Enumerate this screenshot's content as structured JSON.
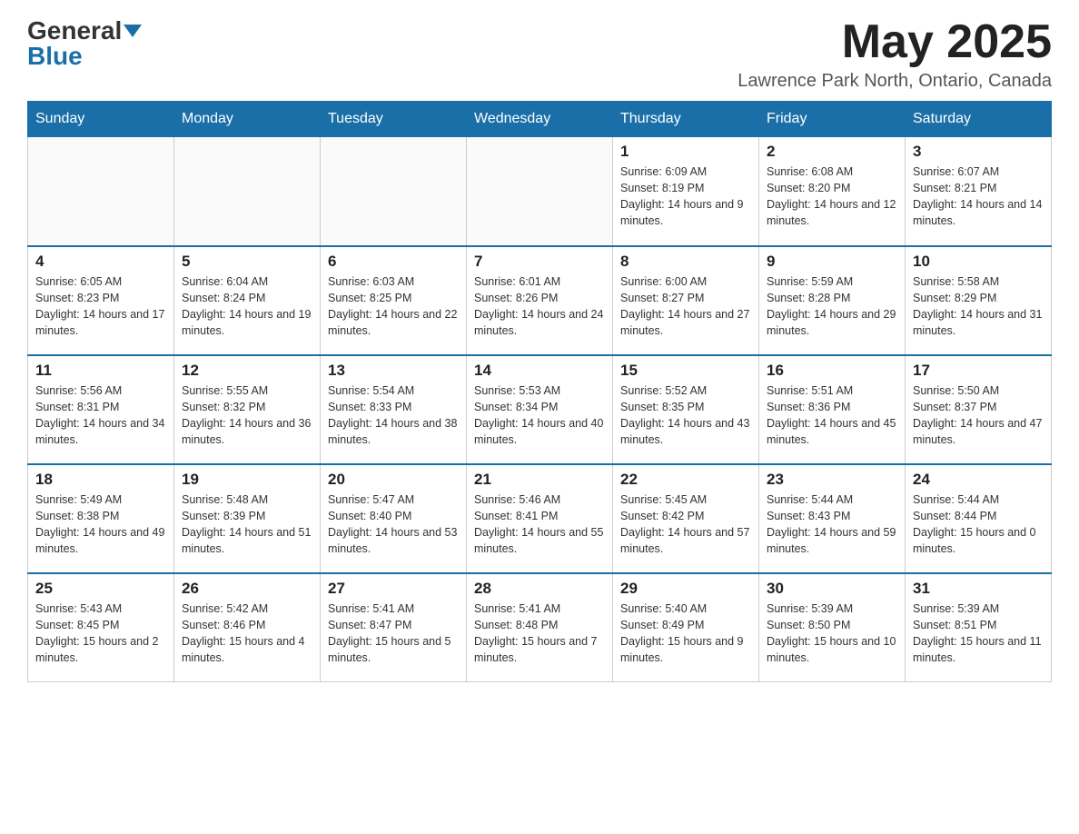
{
  "header": {
    "logo_general": "General",
    "logo_blue": "Blue",
    "month_title": "May 2025",
    "location": "Lawrence Park North, Ontario, Canada"
  },
  "days_of_week": [
    "Sunday",
    "Monday",
    "Tuesday",
    "Wednesday",
    "Thursday",
    "Friday",
    "Saturday"
  ],
  "weeks": [
    [
      {
        "day": "",
        "info": ""
      },
      {
        "day": "",
        "info": ""
      },
      {
        "day": "",
        "info": ""
      },
      {
        "day": "",
        "info": ""
      },
      {
        "day": "1",
        "info": "Sunrise: 6:09 AM\nSunset: 8:19 PM\nDaylight: 14 hours and 9 minutes."
      },
      {
        "day": "2",
        "info": "Sunrise: 6:08 AM\nSunset: 8:20 PM\nDaylight: 14 hours and 12 minutes."
      },
      {
        "day": "3",
        "info": "Sunrise: 6:07 AM\nSunset: 8:21 PM\nDaylight: 14 hours and 14 minutes."
      }
    ],
    [
      {
        "day": "4",
        "info": "Sunrise: 6:05 AM\nSunset: 8:23 PM\nDaylight: 14 hours and 17 minutes."
      },
      {
        "day": "5",
        "info": "Sunrise: 6:04 AM\nSunset: 8:24 PM\nDaylight: 14 hours and 19 minutes."
      },
      {
        "day": "6",
        "info": "Sunrise: 6:03 AM\nSunset: 8:25 PM\nDaylight: 14 hours and 22 minutes."
      },
      {
        "day": "7",
        "info": "Sunrise: 6:01 AM\nSunset: 8:26 PM\nDaylight: 14 hours and 24 minutes."
      },
      {
        "day": "8",
        "info": "Sunrise: 6:00 AM\nSunset: 8:27 PM\nDaylight: 14 hours and 27 minutes."
      },
      {
        "day": "9",
        "info": "Sunrise: 5:59 AM\nSunset: 8:28 PM\nDaylight: 14 hours and 29 minutes."
      },
      {
        "day": "10",
        "info": "Sunrise: 5:58 AM\nSunset: 8:29 PM\nDaylight: 14 hours and 31 minutes."
      }
    ],
    [
      {
        "day": "11",
        "info": "Sunrise: 5:56 AM\nSunset: 8:31 PM\nDaylight: 14 hours and 34 minutes."
      },
      {
        "day": "12",
        "info": "Sunrise: 5:55 AM\nSunset: 8:32 PM\nDaylight: 14 hours and 36 minutes."
      },
      {
        "day": "13",
        "info": "Sunrise: 5:54 AM\nSunset: 8:33 PM\nDaylight: 14 hours and 38 minutes."
      },
      {
        "day": "14",
        "info": "Sunrise: 5:53 AM\nSunset: 8:34 PM\nDaylight: 14 hours and 40 minutes."
      },
      {
        "day": "15",
        "info": "Sunrise: 5:52 AM\nSunset: 8:35 PM\nDaylight: 14 hours and 43 minutes."
      },
      {
        "day": "16",
        "info": "Sunrise: 5:51 AM\nSunset: 8:36 PM\nDaylight: 14 hours and 45 minutes."
      },
      {
        "day": "17",
        "info": "Sunrise: 5:50 AM\nSunset: 8:37 PM\nDaylight: 14 hours and 47 minutes."
      }
    ],
    [
      {
        "day": "18",
        "info": "Sunrise: 5:49 AM\nSunset: 8:38 PM\nDaylight: 14 hours and 49 minutes."
      },
      {
        "day": "19",
        "info": "Sunrise: 5:48 AM\nSunset: 8:39 PM\nDaylight: 14 hours and 51 minutes."
      },
      {
        "day": "20",
        "info": "Sunrise: 5:47 AM\nSunset: 8:40 PM\nDaylight: 14 hours and 53 minutes."
      },
      {
        "day": "21",
        "info": "Sunrise: 5:46 AM\nSunset: 8:41 PM\nDaylight: 14 hours and 55 minutes."
      },
      {
        "day": "22",
        "info": "Sunrise: 5:45 AM\nSunset: 8:42 PM\nDaylight: 14 hours and 57 minutes."
      },
      {
        "day": "23",
        "info": "Sunrise: 5:44 AM\nSunset: 8:43 PM\nDaylight: 14 hours and 59 minutes."
      },
      {
        "day": "24",
        "info": "Sunrise: 5:44 AM\nSunset: 8:44 PM\nDaylight: 15 hours and 0 minutes."
      }
    ],
    [
      {
        "day": "25",
        "info": "Sunrise: 5:43 AM\nSunset: 8:45 PM\nDaylight: 15 hours and 2 minutes."
      },
      {
        "day": "26",
        "info": "Sunrise: 5:42 AM\nSunset: 8:46 PM\nDaylight: 15 hours and 4 minutes."
      },
      {
        "day": "27",
        "info": "Sunrise: 5:41 AM\nSunset: 8:47 PM\nDaylight: 15 hours and 5 minutes."
      },
      {
        "day": "28",
        "info": "Sunrise: 5:41 AM\nSunset: 8:48 PM\nDaylight: 15 hours and 7 minutes."
      },
      {
        "day": "29",
        "info": "Sunrise: 5:40 AM\nSunset: 8:49 PM\nDaylight: 15 hours and 9 minutes."
      },
      {
        "day": "30",
        "info": "Sunrise: 5:39 AM\nSunset: 8:50 PM\nDaylight: 15 hours and 10 minutes."
      },
      {
        "day": "31",
        "info": "Sunrise: 5:39 AM\nSunset: 8:51 PM\nDaylight: 15 hours and 11 minutes."
      }
    ]
  ]
}
